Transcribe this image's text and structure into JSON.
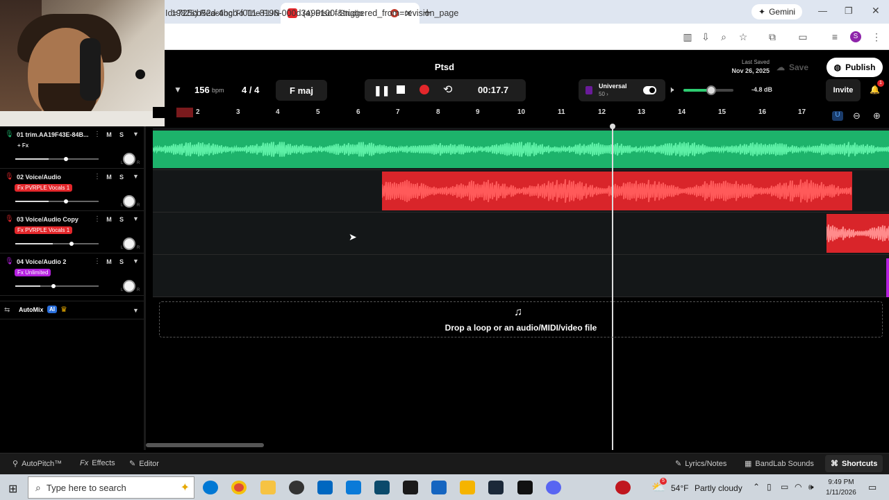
{
  "browser": {
    "tabs": [
      {
        "label": "19825) Reacting To The FUNNIE"
      },
      {
        "label": "(4) Ptsd - Studio"
      }
    ],
    "gemini_label": "Gemini",
    "url": "Id=725cb52d-4bcb-f011-8196-000d3a96100f&triggered_from=revision_page"
  },
  "studio": {
    "title": "Ptsd",
    "last_saved_label": "Last Saved",
    "last_saved_date": "Nov 26, 2025",
    "save_label": "Save",
    "publish_label": "Publish",
    "invite_label": "Invite",
    "notification_count": "1",
    "bpm_value": "156",
    "bpm_unit": "bpm",
    "time_signature": "4 / 4",
    "key": "F maj",
    "time": "00:17.7",
    "preset_name": "Universal",
    "preset_sub": "50 ›",
    "volume_db": "-4.8 dB",
    "volume_level": 0.55,
    "ruler": [
      "2",
      "3",
      "4",
      "5",
      "6",
      "7",
      "8",
      "9",
      "10",
      "11",
      "12",
      "13",
      "14",
      "15",
      "16",
      "17"
    ]
  },
  "tracks": [
    {
      "name": "01  trim.AA19F43E-84B...",
      "fx": "+ Fx",
      "volume": 0.4
    },
    {
      "name": "02  Voice/Audio",
      "fx": "Fx PVRPLE Vocals 1",
      "volume": 0.4
    },
    {
      "name": "03  Voice/Audio Copy",
      "fx": "Fx PVRPLE Vocals 1",
      "volume": 0.45
    },
    {
      "name": "04  Voice/Audio 2",
      "fx": "Fx Unlimited",
      "volume": 0.3
    }
  ],
  "track_buttons": {
    "mute": "M",
    "solo": "S",
    "pan_l": "L",
    "pan_r": "R"
  },
  "automix": {
    "label": "AutoMix",
    "ai_badge": "AI"
  },
  "dropzone_text": "Drop a loop or an audio/MIDI/video file",
  "bottom": {
    "autopitch": "AutoPitch™",
    "effects": "Effects",
    "editor": "Editor",
    "lyrics": "Lyrics/Notes",
    "sounds": "BandLab Sounds",
    "shortcuts": "Shortcuts"
  },
  "taskbar": {
    "search_placeholder": "Type here to search",
    "weather_temp": "54°F",
    "weather_desc": "Partly cloudy",
    "weather_badge": "5",
    "time": "9:49 PM",
    "date": "1/11/2026"
  },
  "colors": {
    "green": "#1db36b",
    "red": "#e3272b",
    "purple": "#b620e0",
    "accent": "#2aa5ff"
  }
}
